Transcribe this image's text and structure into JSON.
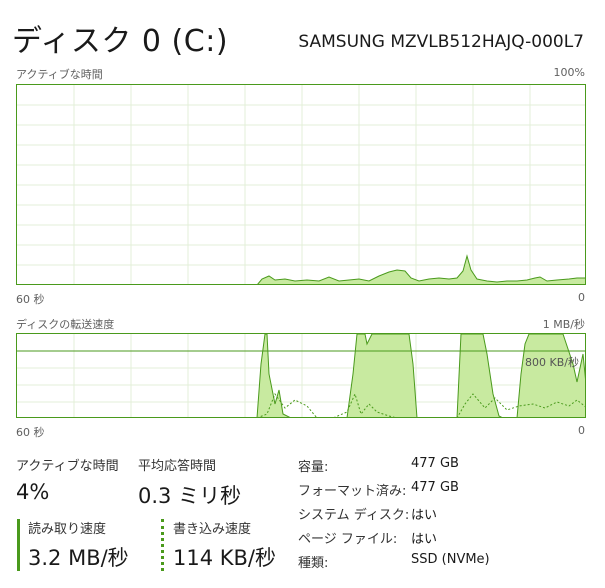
{
  "header": {
    "title": "ディスク 0 (C:)",
    "model": "SAMSUNG MZVLB512HAJQ-000L7"
  },
  "active_graph": {
    "label": "アクティブな時間",
    "max_label": "100%",
    "left_label": "60 秒",
    "right_label": "0"
  },
  "transfer_graph": {
    "label": "ディスクの転送速度",
    "max_label": "1 MB/秒",
    "ref_label": "800 KB/秒",
    "left_label": "60 秒",
    "right_label": "0"
  },
  "stats": {
    "active_time_label": "アクティブな時間",
    "active_time_value": "4%",
    "response_time_label": "平均応答時間",
    "response_time_value": "0.3 ミリ秒",
    "read_speed_label": "読み取り速度",
    "read_speed_value": "3.2 MB/秒",
    "write_speed_label": "書き込み速度",
    "write_speed_value": "114 KB/秒"
  },
  "properties": [
    {
      "label": "容量:",
      "value": "477 GB"
    },
    {
      "label": "フォーマット済み:",
      "value": "477 GB"
    },
    {
      "label": "システム ディスク:",
      "value": "はい"
    },
    {
      "label": "ページ ファイル:",
      "value": "はい"
    },
    {
      "label": "種類:",
      "value": "SSD (NVMe)"
    }
  ],
  "colors": {
    "accent": "#4a9a1c",
    "fill": "#c8eaa0",
    "grid": "#e3efd8"
  }
}
